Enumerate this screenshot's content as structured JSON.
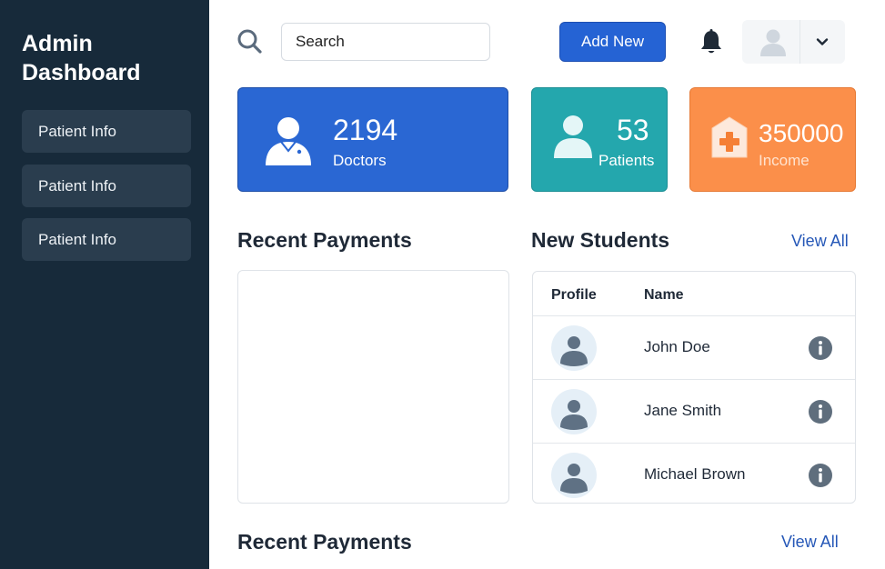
{
  "sidebar": {
    "title_line1": "Admin",
    "title_line2": "Dashboard",
    "items": [
      {
        "label": "Patient Info"
      },
      {
        "label": "Patient Info"
      },
      {
        "label": "Patient Info"
      }
    ]
  },
  "header": {
    "search_placeholder": "Search",
    "add_button_label": "Add New",
    "icons": [
      "search-icon",
      "bell-icon",
      "user-avatar-icon",
      "chevron-down-icon"
    ]
  },
  "stats": [
    {
      "value": "2194",
      "label": "Doctors",
      "icon": "doctor-icon",
      "color": "#2a67d3"
    },
    {
      "value": "53",
      "label": "Patients",
      "icon": "patient-icon",
      "color": "#24a7ad"
    },
    {
      "value": "350000",
      "label": "Income",
      "icon": "hospital-icon",
      "color": "#fb8f4a"
    }
  ],
  "recent_payments": {
    "title": "Recent Payments"
  },
  "new_students": {
    "title": "New Students",
    "view_all": "View All",
    "columns": [
      "Profile",
      "Name"
    ],
    "rows": [
      {
        "name": "John Doe"
      },
      {
        "name": "Jane Smith"
      },
      {
        "name": "Michael Brown"
      }
    ]
  },
  "recent_payments_bottom": {
    "title": "Recent Payments",
    "view_all": "View All"
  },
  "colors": {
    "sidebar_bg": "#172a3a",
    "nav_item_bg": "#2a3d4e",
    "accent": "#2563d4",
    "link": "#2557b7"
  }
}
